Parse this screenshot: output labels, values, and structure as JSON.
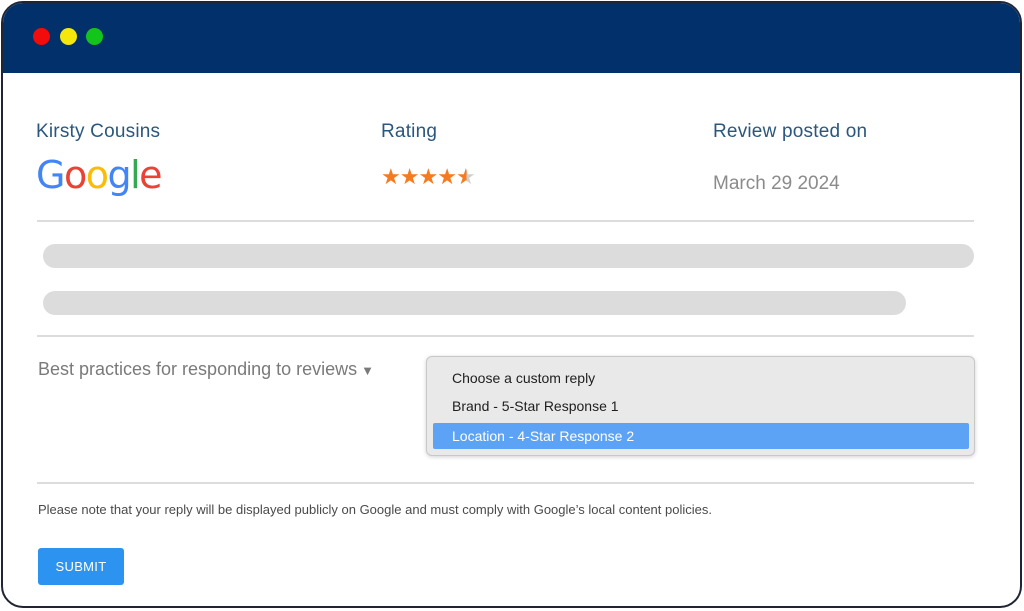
{
  "window": {
    "controls": [
      "close",
      "minimize",
      "maximize"
    ]
  },
  "review": {
    "reviewer_name": "Kirsty Cousins",
    "platform_logo": "Google",
    "rating_label": "Rating",
    "rating_value": 4.5,
    "rating_max": 5,
    "posted_label": "Review posted on",
    "posted_date": "March 29 2024"
  },
  "reply": {
    "best_practices_label": "Best practices for responding to reviews",
    "best_practices_icon": "triangle-down-icon",
    "dropdown_options": [
      "Choose a custom reply",
      "Brand - 5-Star Response 1",
      "Location - 4-Star Response 2"
    ],
    "selected_index": 2,
    "note": "Please note that your reply will be displayed publicly on Google and must comply with Google’s local content policies.",
    "submit_label": "SUBMIT"
  },
  "colors": {
    "titlebar": "#01306a",
    "heading": "#2b577e",
    "star": "#f47b20",
    "selected_option": "#5ca3f6",
    "submit": "#2c93f0"
  }
}
